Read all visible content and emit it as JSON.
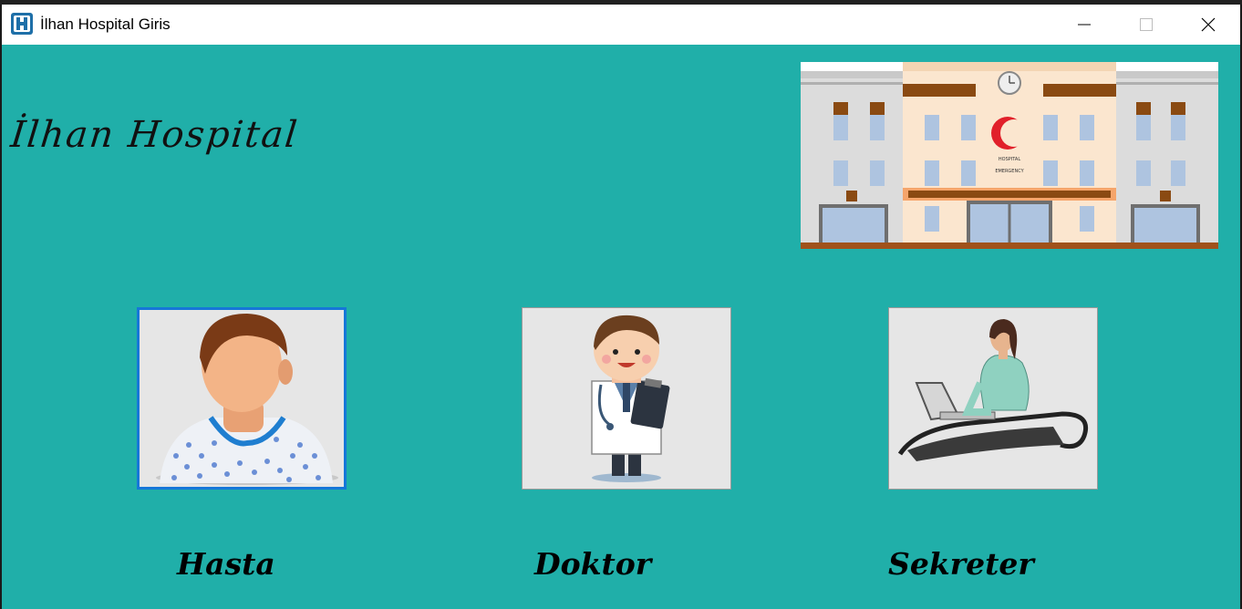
{
  "window": {
    "title": "İlhan Hospital Giris",
    "controls": [
      "minimize",
      "maximize",
      "close"
    ]
  },
  "header": {
    "logo_text": "İlhan Hospital"
  },
  "roles": [
    {
      "label": "Hasta",
      "icon": "patient-icon"
    },
    {
      "label": "Doktor",
      "icon": "doctor-icon"
    },
    {
      "label": "Sekreter",
      "icon": "secretary-icon"
    }
  ],
  "colors": {
    "background": "#20AFA9",
    "focus_border": "#1677d8"
  }
}
